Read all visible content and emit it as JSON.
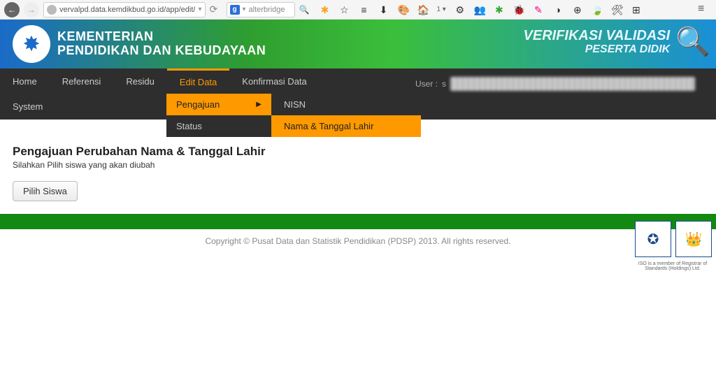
{
  "browser": {
    "url": "vervalpd.data.kemdikbud.go.id/app/edit/",
    "search_engine": "g",
    "search_text": "alterbridge",
    "bookmark_labels": [
      "✱",
      "☆",
      "≡",
      "⬇",
      "🎨",
      "🏠",
      "1 ▾",
      "⚙",
      "👥",
      "✱",
      "🐞",
      "✎",
      "◑",
      "⊕",
      "🍃",
      "🛠",
      "⊞",
      "≡"
    ]
  },
  "banner": {
    "ministry_line1": "KEMENTERIAN",
    "ministry_line2": "PENDIDIKAN DAN KEBUDAYAAN",
    "right_line1": "VERIFIKASI VALIDASI",
    "right_line2": "PESERTA DIDIK"
  },
  "nav": {
    "items_row1": [
      "Home",
      "Referensi",
      "Residu",
      "Edit Data",
      "Konfirmasi Data"
    ],
    "items_row2": [
      "System"
    ],
    "active": "Edit Data",
    "user_label": "User :",
    "user_initial": "s"
  },
  "dropdown1": {
    "items": [
      {
        "label": "Pengajuan",
        "hover": true,
        "submenu": true
      },
      {
        "label": "Status",
        "hover": false,
        "submenu": false
      }
    ]
  },
  "dropdown2": {
    "items": [
      {
        "label": "NISN",
        "hover": false
      },
      {
        "label": "Nama & Tanggal Lahir",
        "hover": true
      }
    ]
  },
  "main": {
    "title": "Pengajuan Perubahan Nama & Tanggal Lahir",
    "subtitle": "Silahkan Pilih siswa yang akan diubah",
    "button": "Pilih Siswa"
  },
  "footer": {
    "copyright": "Copyright © Pusat Data dan Statistik Pendidikan (PDSP) 2013. All rights reserved.",
    "cert_sub": "ISO is a member of Registrar of Standards (Holdings) Ltd."
  }
}
